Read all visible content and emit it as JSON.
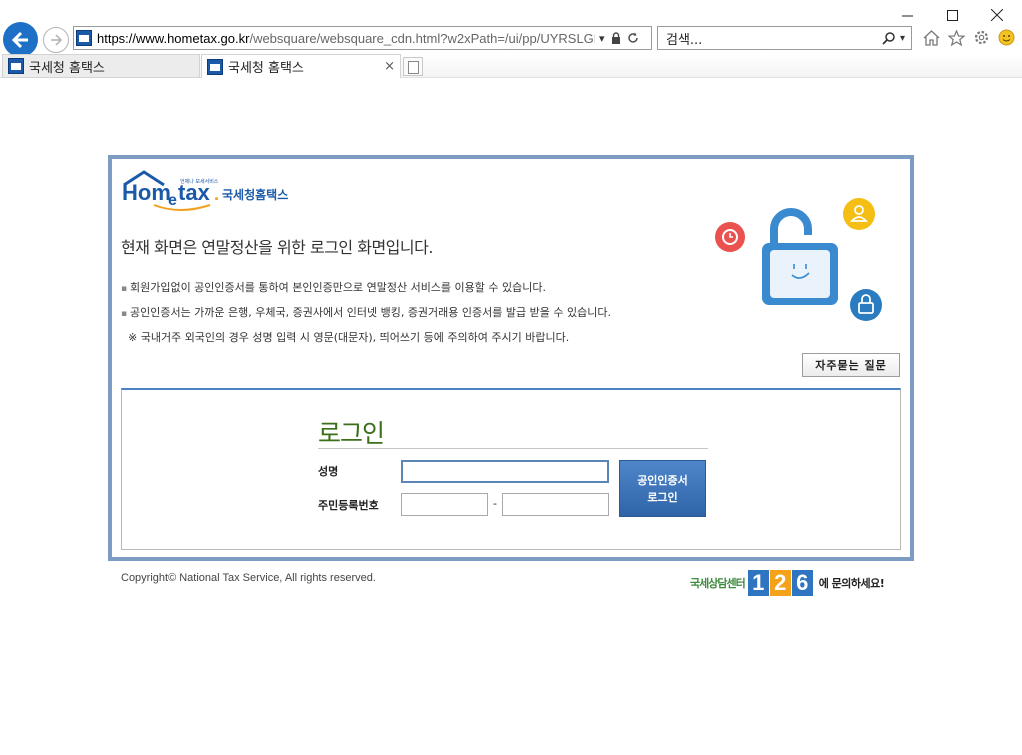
{
  "browser": {
    "url_host": "https://www.hometax.go.kr",
    "url_rest": "/websquare/websquare_cdn.html?w2xPath=/ui/pp/UYRSLGNEXE.:",
    "search_placeholder": "검색...",
    "window_controls": [
      "minimize-icon",
      "maximize-icon",
      "close-icon"
    ],
    "tabs": [
      {
        "label": "국세청 홈택스",
        "active": false
      },
      {
        "label": "국세청 홈택스",
        "active": true
      }
    ],
    "tab_close": "×"
  },
  "page": {
    "logo": {
      "brand": "Home tax",
      "subtitle": "국세청홈택스",
      "tagline": "언제나 보세서비스"
    },
    "headline": "현재 화면은 연말정산을 위한 로그인 화면입니다.",
    "bullets": [
      "회원가입없이 공인인증서를 통하여 본인인증만으로 연말정산 서비스를 이용할 수 있습니다.",
      "공인인증서는 가까운 은행, 우체국, 증권사에서 인터넷 뱅킹, 증권거래용 인증서를 발급 받을 수 있습니다."
    ],
    "note": "※ 국내거주 외국인의 경우 성명 입력 시 영문(대문자), 띄어쓰기 등에 주의하여 주시기 바랍니다.",
    "faq_button": "자주묻는 질문",
    "login": {
      "title": "로그인",
      "name_label": "성명",
      "rrn_label": "주민등록번호",
      "rrn_separator": "-",
      "cert_button_line1": "공인인증서",
      "cert_button_line2": "로그인"
    },
    "copyright": "Copyright© National Tax Service,  All rights reserved.",
    "callcenter": {
      "prefix": "국세상담센터",
      "digits": [
        "1",
        "2",
        "6"
      ],
      "suffix": "에 문의하세요!"
    }
  },
  "colors": {
    "frame_border": "#7d9cc4",
    "accent_blue": "#1e6fc6",
    "login_title": "#3b6f1a",
    "cc_digit_1": "#2f74c0",
    "cc_digit_2": "#f5a21b",
    "cc_digit_3": "#2f74c0"
  }
}
